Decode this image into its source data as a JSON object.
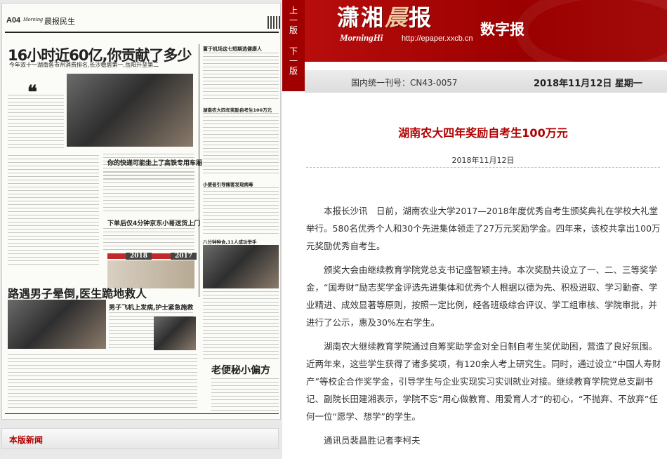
{
  "newspaper_page": {
    "page_number": "A04",
    "masthead": "Morning",
    "section": "晨报民生",
    "headline": "16小时近60亿,你贡献了多少",
    "subheadline": "今年双十一湖南各市州消费排名,长沙稳居第一,岳阳升至第二",
    "quote_mark": "❝",
    "story2_title": "你的快递可能坐上了高铁专用车厢",
    "story3_title": "下单后仅4分钟京东小哥送货上门",
    "year_left": "2018",
    "year_right": "2017",
    "story4_title": "路遇男子晕倒,医生跪地救人",
    "story5_title": "男子飞机上发病,护士紧急施救",
    "story6_title": "老便秘小偏方",
    "right_col_title1": "置于机场这七短期选健康人",
    "right_col_title2": "湖南农大四年奖励自考生100万元",
    "right_col_title3": "小便者引导痛客发现病毒",
    "right_col_title4": "八分钟种合,11人成功举手"
  },
  "pager": {
    "prev_label": "上一版",
    "next_label": "下一版"
  },
  "header": {
    "brand_cn_a": "潇湘",
    "brand_cn_b": "晨",
    "brand_cn_c": "报",
    "brand_en": "MorningHi",
    "url": "http://epaper.xxcb.cn",
    "digital_label": "数字报",
    "issn": "国内统一刊号：CN43-0057",
    "date": "2018年11月12日 星期一"
  },
  "article": {
    "title": "湖南农大四年奖励自考生100万元",
    "date": "2018年11月12日",
    "paragraphs": [
      "本报长沙讯　日前，湖南农业大学2017—2018年度优秀自考生颁奖典礼在学校大礼堂举行。580名优秀个人和30个先进集体领走了27万元奖励学金。四年来，该校共拿出100万元奖励优秀自考生。",
      "颁奖大会由继续教育学院党总支书记盛智颖主持。本次奖励共设立了一、二、三等奖学金，“国寿财”励志奖学金评选先进集体和优秀个人根据以德为先、积极进取、学习勤奋、学业精进、成效显著等原则，按照一定比例，经各班级综合评议、学工组审核、学院审批，并进行了公示，惠及30%左右学生。",
      "湖南农大继续教育学院通过自筹奖助学金对全日制自考生奖优助困，营造了良好氛围。近两年来，这些学生获得了诸多奖项，有120余人考上研究生。同时，通过设立“中国人寿财产”等校企合作奖学金，引导学生与企业实现实习实训就业对接。继续教育学院党总支副书记、副院长田建湘表示，学院不忘“用心做教育、用爱育人才”的初心，“不抛弃、不放弃”任何一位“愿学、想学”的学生。",
      "通讯员裴昌胜记者李柯夫"
    ]
  },
  "bottom": {
    "section_label": "本版新闻"
  },
  "colors": {
    "brand_red": "#a00000",
    "title_red": "#b00000"
  }
}
